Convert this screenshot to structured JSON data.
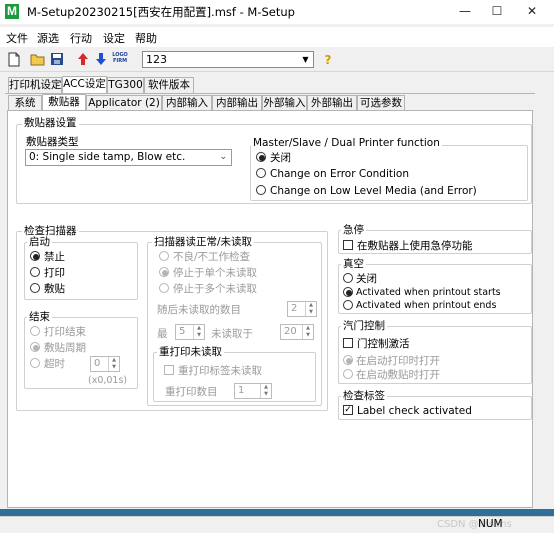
{
  "window": {
    "title": "M-Setup20230215[西安在用配置].msf - M-Setup",
    "logo_letter": "M",
    "minimize": "—",
    "maximize": "☐",
    "close": "✕"
  },
  "menu": {
    "items": [
      "文件",
      "源选",
      "行动",
      "设定",
      "帮助"
    ]
  },
  "toolbar": {
    "profile_value": "123",
    "logo_button": "LOGO FIRM",
    "icons": [
      "new-file-icon",
      "open-folder-icon",
      "save-icon",
      "upload-arrow-icon",
      "download-arrow-icon",
      "logo-firmware-icon",
      "filter-icon",
      "help-icon"
    ]
  },
  "tabs_top": [
    "打印机设定",
    "ACC设定",
    "TG300",
    "软件版本"
  ],
  "tabs_sub": [
    "系统",
    "敷贴器",
    "Applicator (2)",
    "内部输入",
    "内部输出",
    "外部输入",
    "外部输出",
    "可选参数"
  ],
  "applicator_settings": {
    "group_title": "敷贴器设置",
    "type_label": "敷贴器类型",
    "type_value": "0: Single side tamp, Blow etc.",
    "master_slave": {
      "title": "Master/Slave / Dual Printer function",
      "options": [
        "关闭",
        "Change on Error Condition",
        "Change on Low Level Media (and Error)"
      ],
      "selected": 0
    }
  },
  "scanner": {
    "group_title": "检查扫描器",
    "start": {
      "title": "启动",
      "options": [
        "禁止",
        "打印",
        "敷贴"
      ],
      "selected": 0
    },
    "end": {
      "title": "结束",
      "options": [
        "打印结束",
        "敷贴周期",
        "超时"
      ],
      "selected": 1,
      "timeout_value": "0",
      "timeout_unit": "(x0,01s)"
    },
    "read": {
      "title": "扫描器读正常/未读取",
      "options": [
        "不良/不工作检查",
        "停止于单个未读取",
        "停止于多个未读取"
      ],
      "selected": 1,
      "subsequent_label": "随后未读取的数目",
      "subsequent_value": "2",
      "max_label": "最",
      "max_value": "5",
      "unread_label": "未读取于",
      "unread_value": "20"
    },
    "reprint": {
      "title": "重打印未读取",
      "checkbox": "重打印标签未读取",
      "count_label": "重打印数目",
      "count_value": "1"
    }
  },
  "estop": {
    "title": "急停",
    "checkbox": "在敷贴器上使用急停功能",
    "checked": false
  },
  "vacuum": {
    "title": "真空",
    "options": [
      "关闭",
      "Activated when printout starts",
      "Activated when printout ends"
    ],
    "selected": 1
  },
  "airgate": {
    "title": "汽门控制",
    "checkbox": "门控制激活",
    "options": [
      "在启动打印时打开",
      "在启动敷贴时打开"
    ],
    "selected": 0
  },
  "label_check": {
    "title": "检查标签",
    "checkbox": "Label check activated",
    "checked": true
  },
  "statusbar": {
    "num": "NUM",
    "watermark": "CSDN @rasens"
  }
}
